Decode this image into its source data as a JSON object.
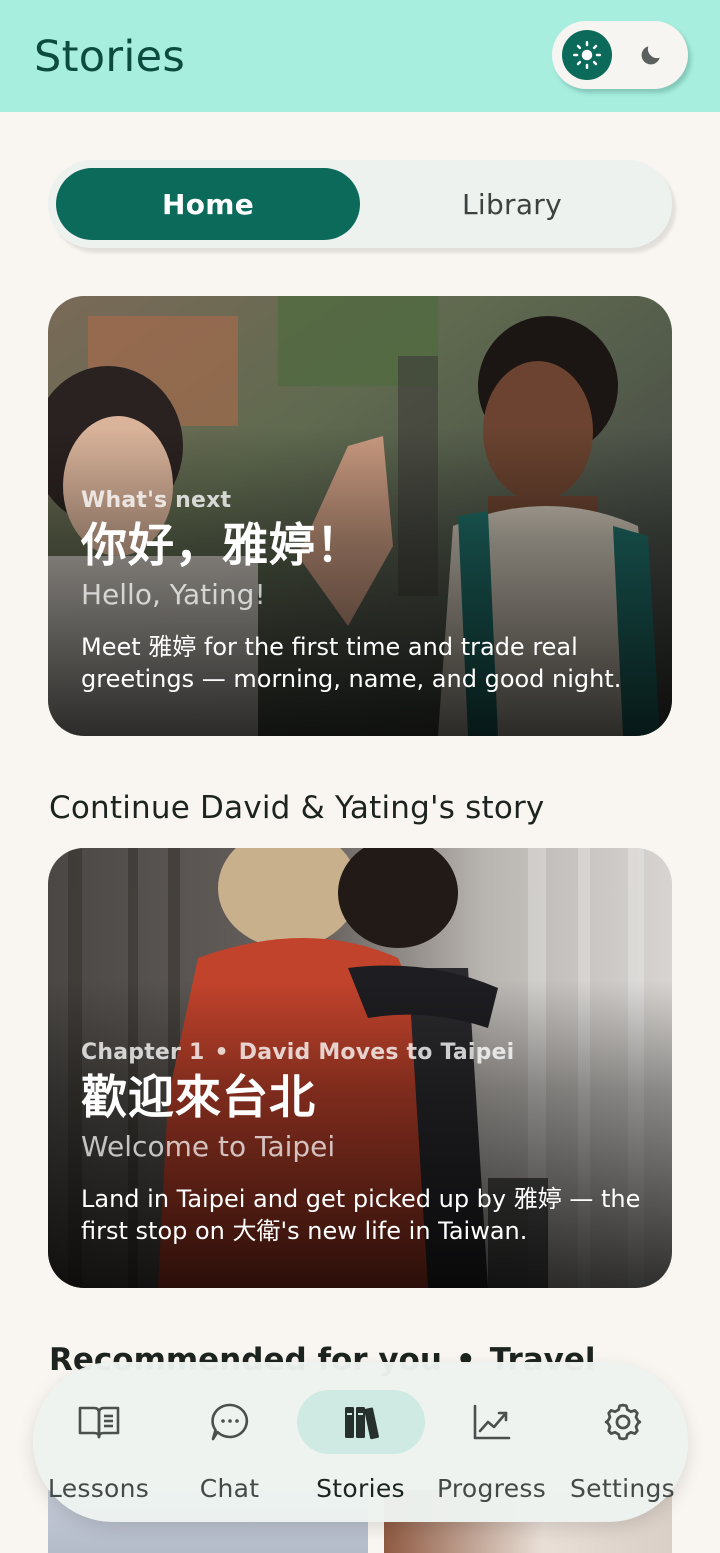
{
  "header": {
    "title": "Stories",
    "theme_toggle": {
      "options": [
        "light",
        "dark"
      ],
      "selected": "light",
      "light_icon": "sun-icon",
      "dark_icon": "moon-icon"
    }
  },
  "segmented": {
    "selected": "Home",
    "tabs": [
      {
        "label": "Home"
      },
      {
        "label": "Library"
      }
    ]
  },
  "hero_card": {
    "kicker": "What's next",
    "title_zh": "你好，雅婷！",
    "title_en": "Hello, Yating!",
    "description": "Meet 雅婷 for the first time and trade real greetings — morning, name, and good night."
  },
  "continue_section": {
    "title": "Continue David & Yating's story",
    "card": {
      "chapter": "Chapter 1",
      "separator": "•",
      "story": "David Moves to Taipei",
      "title_zh": "歡迎來台北",
      "title_en": "Welcome to Taipei",
      "description": "Land in Taipei and get picked up by 雅婷 — the first stop on 大衛's new life in Taiwan."
    }
  },
  "recommended": {
    "title": "Recommended for you",
    "separator": "•",
    "topic": "Travel"
  },
  "bottom_nav": {
    "selected": "Stories",
    "items": [
      {
        "label": "Lessons",
        "icon": "book-open-icon"
      },
      {
        "label": "Chat",
        "icon": "chat-bubble-icon"
      },
      {
        "label": "Stories",
        "icon": "books-icon"
      },
      {
        "label": "Progress",
        "icon": "trend-chart-icon"
      },
      {
        "label": "Settings",
        "icon": "gear-icon"
      }
    ]
  },
  "colors": {
    "appbar_bg": "#a8eedf",
    "primary": "#0c6a5b",
    "page_bg": "#f9f6f1",
    "nav_active_pill": "#cfeae2"
  }
}
